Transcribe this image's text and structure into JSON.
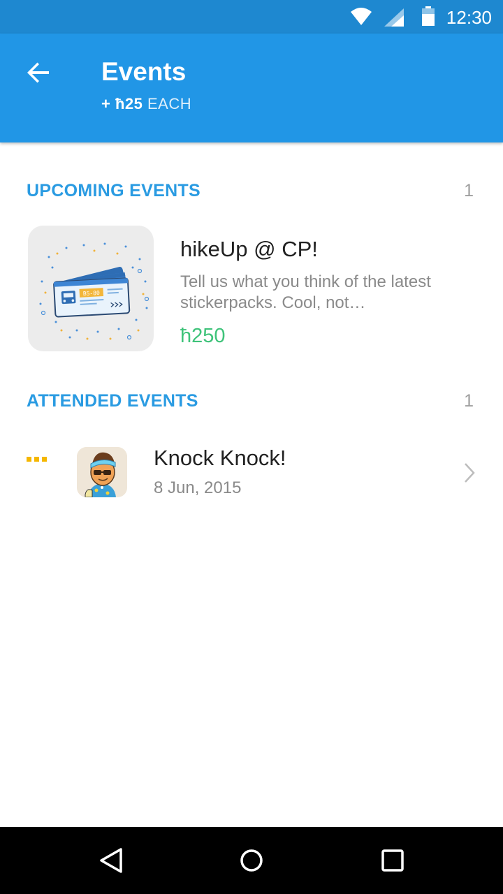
{
  "status_bar": {
    "time": "12:30",
    "icons": [
      "wifi-icon",
      "cell-signal-icon",
      "battery-icon"
    ]
  },
  "app_bar": {
    "title": "Events",
    "subtitle_amount": "+ ħ25",
    "subtitle_each": "EACH",
    "back_icon": "arrow-left-icon"
  },
  "upcoming": {
    "label": "UPCOMING EVENTS",
    "count": "1",
    "events": [
      {
        "title": "hikeUp @ CP!",
        "description": "Tell us what you think of the latest stickerpacks. Cool, not…",
        "reward": "ħ250",
        "thumbnail_icon": "ticket-icon",
        "ticket_text": "BS-80"
      }
    ]
  },
  "attended": {
    "label": "ATTENDED EVENTS",
    "count": "1",
    "events": [
      {
        "title": "Knock Knock!",
        "date": "8 Jun, 2015",
        "thumbnail_icon": "character-sticker-icon"
      }
    ]
  },
  "nav_bar": {
    "icons": [
      "back-triangle-icon",
      "home-circle-icon",
      "recents-square-icon"
    ]
  },
  "colors": {
    "status_bar": "#1e88d0",
    "app_bar": "#2196e6",
    "section_label": "#2a9be2",
    "reward": "#3fc37a",
    "dots": "#f5b700"
  }
}
